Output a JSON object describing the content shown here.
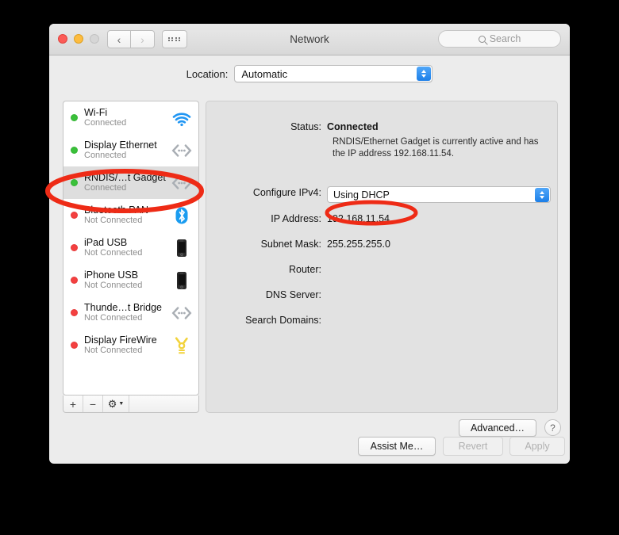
{
  "window": {
    "title": "Network",
    "traffic_lights": [
      "close",
      "minimize",
      "zoom"
    ],
    "search": {
      "placeholder": "Search",
      "value": ""
    }
  },
  "location": {
    "label": "Location:",
    "selected": "Automatic",
    "options": [
      "Automatic"
    ]
  },
  "sidebar": {
    "services": [
      {
        "name": "Wi-Fi",
        "status": "Connected",
        "state": "connected",
        "icon": "wifi-icon",
        "selected": false
      },
      {
        "name": "Display Ethernet",
        "status": "Connected",
        "state": "connected",
        "icon": "ethernet-icon",
        "selected": false
      },
      {
        "name": "RNDIS/…t Gadget",
        "status": "Connected",
        "state": "connected",
        "icon": "ethernet-icon",
        "selected": true
      },
      {
        "name": "Bluetooth PAN",
        "status": "Not Connected",
        "state": "not-connected",
        "icon": "bluetooth-icon",
        "selected": false
      },
      {
        "name": "iPad USB",
        "status": "Not Connected",
        "state": "not-connected",
        "icon": "phone-icon",
        "selected": false
      },
      {
        "name": "iPhone USB",
        "status": "Not Connected",
        "state": "not-connected",
        "icon": "phone-icon",
        "selected": false
      },
      {
        "name": "Thunde…t Bridge",
        "status": "Not Connected",
        "state": "not-connected",
        "icon": "ethernet-icon",
        "selected": false
      },
      {
        "name": "Display FireWire",
        "status": "Not Connected",
        "state": "not-connected",
        "icon": "firewire-icon",
        "selected": false
      }
    ],
    "toolbar": {
      "add_label": "+",
      "remove_label": "−",
      "action_label": "gear-icon"
    }
  },
  "detail": {
    "status_label": "Status:",
    "status_value": "Connected",
    "status_description": "RNDIS/Ethernet Gadget is currently active and has the IP address 192.168.11.54.",
    "configure_ipv4_label": "Configure IPv4:",
    "configure_ipv4_value": "Using DHCP",
    "ip_address_label": "IP Address:",
    "ip_address_value": "192.168.11.54",
    "subnet_mask_label": "Subnet Mask:",
    "subnet_mask_value": "255.255.255.0",
    "router_label": "Router:",
    "router_value": "",
    "dns_server_label": "DNS Server:",
    "dns_server_value": "",
    "search_domains_label": "Search Domains:",
    "search_domains_value": ""
  },
  "buttons": {
    "advanced": "Advanced…",
    "help": "?",
    "assist_me": "Assist Me…",
    "revert": "Revert",
    "apply": "Apply"
  },
  "annotations": {
    "color": "#ee2b16",
    "items": [
      {
        "target": "sidebar-service-rndis",
        "shape": "ellipse"
      },
      {
        "target": "ip-address-value",
        "shape": "ellipse"
      }
    ]
  },
  "colors": {
    "connected_dot": "#3ac13a",
    "disconnected_dot": "#f44040",
    "accent_blue": "#1c7fe8",
    "annotation_red": "#ee2b16"
  }
}
